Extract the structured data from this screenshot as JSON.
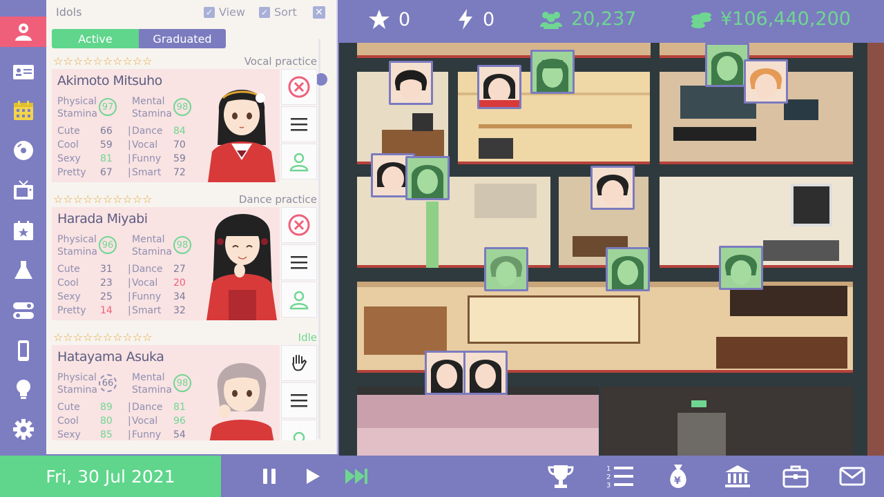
{
  "panel": {
    "title": "Idols",
    "view_label": "View",
    "sort_label": "Sort",
    "tabs": {
      "active": "Active",
      "graduated": "Graduated"
    }
  },
  "idols": [
    {
      "name": "Akimoto Mitsuho",
      "activity": "Vocal practice",
      "stars": "☆☆☆☆☆☆☆☆☆☆",
      "physical_label": "Physical",
      "stamina_label": "Stamina",
      "mental_label": "Mental",
      "physical_stamina": "97",
      "mental_stamina": "98",
      "stats": [
        {
          "l": "Cute",
          "v": "66",
          "l2": "Dance",
          "v2": "84"
        },
        {
          "l": "Cool",
          "v": "59",
          "l2": "Vocal",
          "v2": "70"
        },
        {
          "l": "Sexy",
          "v": "81",
          "l2": "Funny",
          "v2": "59"
        },
        {
          "l": "Pretty",
          "v": "67",
          "l2": "Smart",
          "v2": "72"
        }
      ]
    },
    {
      "name": "Harada Miyabi",
      "activity": "Dance practice",
      "stars": "☆☆☆☆☆☆☆☆☆☆",
      "physical_label": "Physical",
      "stamina_label": "Stamina",
      "mental_label": "Mental",
      "physical_stamina": "96",
      "mental_stamina": "98",
      "stats": [
        {
          "l": "Cute",
          "v": "31",
          "l2": "Dance",
          "v2": "27"
        },
        {
          "l": "Cool",
          "v": "23",
          "l2": "Vocal",
          "v2": "20"
        },
        {
          "l": "Sexy",
          "v": "25",
          "l2": "Funny",
          "v2": "34"
        },
        {
          "l": "Pretty",
          "v": "14",
          "l2": "Smart",
          "v2": "32"
        }
      ]
    },
    {
      "name": "Hatayama Asuka",
      "activity": "Idle",
      "stars": "☆☆☆☆☆☆☆☆☆☆",
      "physical_label": "Physical",
      "stamina_label": "Stamina",
      "mental_label": "Mental",
      "physical_stamina": "66",
      "mental_stamina": "98",
      "stats": [
        {
          "l": "Cute",
          "v": "89",
          "l2": "Dance",
          "v2": "81"
        },
        {
          "l": "Cool",
          "v": "80",
          "l2": "Vocal",
          "v2": "96"
        },
        {
          "l": "Sexy",
          "v": "85",
          "l2": "Funny",
          "v2": "54"
        }
      ]
    }
  ],
  "topbar": {
    "stars": "0",
    "energy": "0",
    "fans": "20,237",
    "money": "¥106,440,200"
  },
  "bottombar": {
    "date": "Fri, 30 Jul 2021"
  },
  "colors": {
    "accent": "#7b7bbf",
    "green": "#5fd68b",
    "pink": "#f05f7a",
    "star": "#e6a43a"
  },
  "icons": {
    "sidebar": [
      "idol-icon",
      "profile-card-icon",
      "calendar-icon",
      "disc-icon",
      "tv-icon",
      "event-calendar-icon",
      "flask-icon",
      "toggle-icon",
      "phone-icon",
      "lightbulb-icon",
      "gear-icon"
    ],
    "bottom": [
      "pause-icon",
      "play-icon",
      "fast-forward-icon",
      "trophy-icon",
      "ranking-list-icon",
      "money-bag-icon",
      "bank-icon",
      "briefcase-icon",
      "mail-icon"
    ]
  }
}
